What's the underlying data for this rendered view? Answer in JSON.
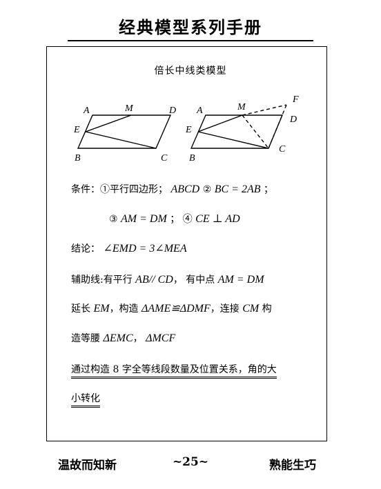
{
  "header": {
    "title": "经典模型系列手册"
  },
  "section_title": "倍长中线类模型",
  "figure_left": {
    "labels": [
      "A",
      "M",
      "D",
      "E",
      "B",
      "C"
    ]
  },
  "figure_right": {
    "labels": [
      "A",
      "M",
      "F",
      "D",
      "E",
      "B",
      "C"
    ]
  },
  "conditions": {
    "label": "条件：",
    "item1_marker": "①",
    "item1_text": "平行四边形；",
    "item1_math": "ABCD",
    "item2_marker": "②",
    "item2_math": "BC = 2AB",
    "item2_end": "；",
    "item3_marker": "③",
    "item3_math": "AM = DM",
    "sep": "；",
    "item4_marker": "④",
    "item4_math": "CE ⊥ AD"
  },
  "conclusion": {
    "label": "结论：",
    "math": "∠EMD = 3∠MEA"
  },
  "auxiliary": {
    "label": "辅助线:",
    "t1": "有平行",
    "m1": "AB// CD",
    "t2": "，  有中点",
    "m2": "AM = DM",
    "t3": "延长",
    "m3": "EM",
    "t4": "，构造",
    "m4": "ΔAME≌ΔDMF",
    "t5": "，连接",
    "m5": "CM",
    "t6": "构",
    "t7": "造等腰",
    "m6": "ΔEMC",
    "t8": "，",
    "m7": "ΔMCF"
  },
  "note": {
    "line1": "通过构造 8 字全等线段数量及位置关系，角的大",
    "line2": "小转化"
  },
  "footer": {
    "left": "温故而知新",
    "page": "~25~",
    "right": "熟能生巧"
  }
}
